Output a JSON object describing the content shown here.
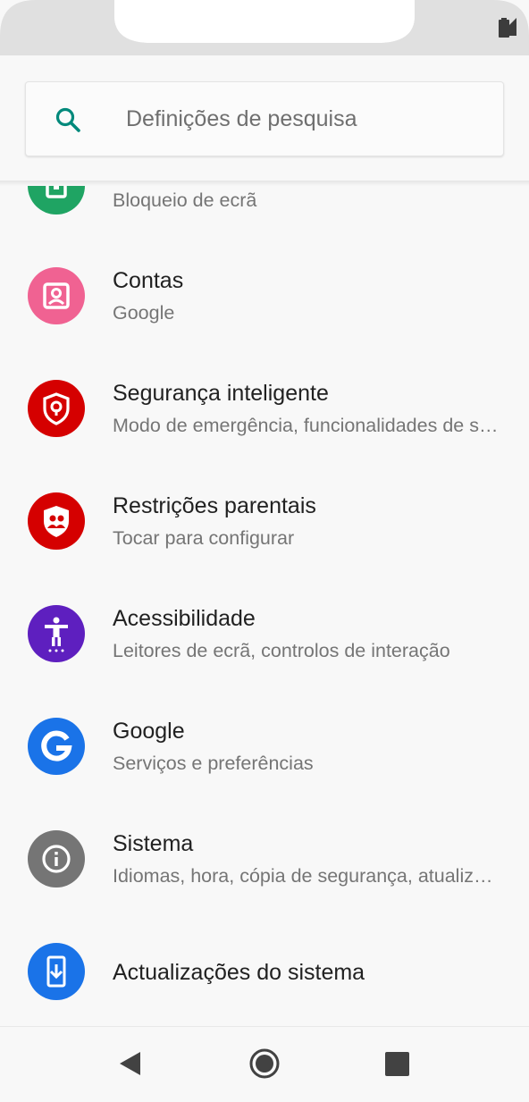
{
  "search": {
    "placeholder": "Definições de pesquisa"
  },
  "colors": {
    "background": "#f8f8f8",
    "accent": "#00897b"
  },
  "items": [
    {
      "title": "",
      "subtitle": "Bloqueio de ecrã",
      "icon": "lock-screen-icon",
      "color": "#1fa463"
    },
    {
      "title": "Contas",
      "subtitle": "Google",
      "icon": "account-box-icon",
      "color": "#f06292"
    },
    {
      "title": "Segurança inteligente",
      "subtitle": "Modo de emergência, funcionalidades de segurança",
      "icon": "shield-keyhole-icon",
      "color": "#d50000"
    },
    {
      "title": "Restrições parentais",
      "subtitle": "Tocar para configurar",
      "icon": "shield-family-icon",
      "color": "#d50000"
    },
    {
      "title": "Acessibilidade",
      "subtitle": "Leitores de ecrã, controlos de interação",
      "icon": "accessibility-icon",
      "color": "#5e1fbf"
    },
    {
      "title": "Google",
      "subtitle": "Serviços e preferências",
      "icon": "google-g-icon",
      "color": "#1a73e8"
    },
    {
      "title": "Sistema",
      "subtitle": "Idiomas, hora, cópia de segurança, atualizações",
      "icon": "info-icon",
      "color": "#757575"
    },
    {
      "title": "Actualizações do sistema",
      "subtitle": "",
      "icon": "system-update-icon",
      "color": "#1a73e8"
    }
  ],
  "nav": {
    "back": "back-icon",
    "home": "home-icon",
    "recents": "recents-icon"
  }
}
